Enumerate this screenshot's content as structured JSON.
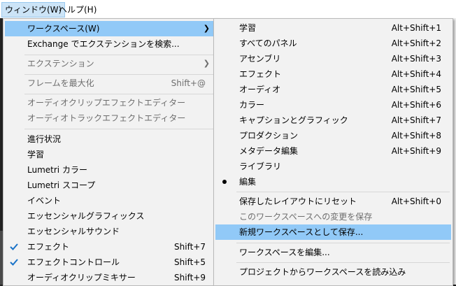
{
  "menubar": {
    "window_label": "ウィンドウ(W)",
    "help_label": "ヘルプ(H)"
  },
  "window_menu": {
    "items": [
      {
        "label": "ワークスペース(W)",
        "shortcut": "",
        "submenu": true,
        "state": "highlighted"
      },
      {
        "label": "Exchange でエクステンションを検索...",
        "shortcut": "",
        "state": "enabled"
      },
      {
        "label": "エクステンション",
        "shortcut": "",
        "submenu": true,
        "state": "disabled"
      },
      {
        "label": "フレームを最大化",
        "shortcut": "Shift+@",
        "state": "disabled"
      },
      {
        "label": "オーディオクリップエフェクトエディター",
        "shortcut": "",
        "state": "disabled"
      },
      {
        "label": "オーディオトラックエフェクトエディター",
        "shortcut": "",
        "state": "disabled"
      },
      {
        "label": "進行状況",
        "shortcut": "",
        "state": "enabled"
      },
      {
        "label": "学習",
        "shortcut": "",
        "state": "enabled"
      },
      {
        "label": "Lumetri カラー",
        "shortcut": "",
        "state": "enabled"
      },
      {
        "label": "Lumetri スコープ",
        "shortcut": "",
        "state": "enabled"
      },
      {
        "label": "イベント",
        "shortcut": "",
        "state": "enabled"
      },
      {
        "label": "エッセンシャルグラフィックス",
        "shortcut": "",
        "state": "enabled"
      },
      {
        "label": "エッセンシャルサウンド",
        "shortcut": "",
        "state": "enabled"
      },
      {
        "label": "エフェクト",
        "shortcut": "Shift+7",
        "checked": true,
        "state": "enabled"
      },
      {
        "label": "エフェクトコントロール",
        "shortcut": "Shift+5",
        "checked": true,
        "state": "enabled"
      },
      {
        "label": "オーディオクリップミキサー",
        "shortcut": "Shift+9",
        "state": "enabled"
      }
    ]
  },
  "workspace_menu": {
    "items": [
      {
        "label": "学習",
        "shortcut": "Alt+Shift+1"
      },
      {
        "label": "すべてのパネル",
        "shortcut": "Alt+Shift+2"
      },
      {
        "label": "アセンブリ",
        "shortcut": "Alt+Shift+3"
      },
      {
        "label": "エフェクト",
        "shortcut": "Alt+Shift+4"
      },
      {
        "label": "オーディオ",
        "shortcut": "Alt+Shift+5"
      },
      {
        "label": "カラー",
        "shortcut": "Alt+Shift+6"
      },
      {
        "label": "キャプションとグラフィック",
        "shortcut": "Alt+Shift+7"
      },
      {
        "label": "プロダクション",
        "shortcut": "Alt+Shift+8"
      },
      {
        "label": "メタデータ編集",
        "shortcut": "Alt+Shift+9"
      },
      {
        "label": "ライブラリ",
        "shortcut": ""
      },
      {
        "label": "編集",
        "shortcut": "",
        "selected": true
      },
      {
        "label": "保存したレイアウトにリセット",
        "shortcut": "Alt+Shift+0"
      },
      {
        "label": "このワークスペースへの変更を保存",
        "shortcut": "",
        "state": "disabled"
      },
      {
        "label": "新規ワークスペースとして保存...",
        "shortcut": "",
        "state": "highlighted"
      },
      {
        "label": "ワークスペースを編集...",
        "shortcut": ""
      },
      {
        "label": "プロジェクトからワークスペースを読み込み",
        "shortcut": ""
      }
    ]
  },
  "icons": {
    "checkmark_color": "#1a73c8",
    "highlight_color": "#91c9f7"
  }
}
